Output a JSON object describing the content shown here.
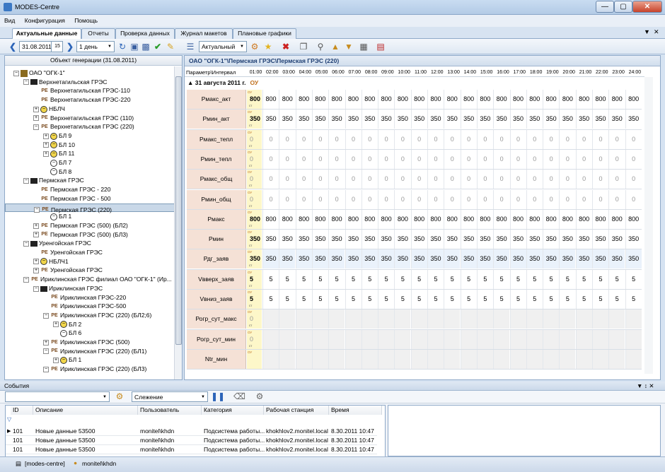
{
  "window": {
    "title": "MODES-Centre"
  },
  "menu": [
    "Вид",
    "Конфигурация",
    "Помощь"
  ],
  "tabs": [
    "Актуальные данные",
    "Отчеты",
    "Проверка данных",
    "Журнал макетов",
    "Плановые графики"
  ],
  "toolbar": {
    "date": "31.08.2011",
    "cal_day": "15",
    "period": "1 день",
    "mode": "Актуальный"
  },
  "left_panel": {
    "header": "Объект генерации (31.08.2011)",
    "tree": [
      {
        "label": "ОАО \"ОГК-1\"",
        "level": 0,
        "exp": "−",
        "icon": "org"
      },
      {
        "label": "Верхнетагильская ГРЭС",
        "level": 1,
        "exp": "−",
        "icon": "plant"
      },
      {
        "label": "Верхнетагильская ГРЭС-110",
        "level": 2,
        "exp": "",
        "icon": "pe"
      },
      {
        "label": "Верхнетагильская ГРЭС-220",
        "level": 2,
        "exp": "",
        "icon": "pe"
      },
      {
        "label": "НБЛЧ",
        "level": 2,
        "exp": "+",
        "icon": "geny"
      },
      {
        "label": "Верхнетагильская ГРЭС (110)",
        "level": 2,
        "exp": "+",
        "icon": "pe"
      },
      {
        "label": "Верхнетагильская ГРЭС (220)",
        "level": 2,
        "exp": "−",
        "icon": "pe"
      },
      {
        "label": "БЛ 9",
        "level": 3,
        "exp": "+",
        "icon": "geny"
      },
      {
        "label": "БЛ 10",
        "level": 3,
        "exp": "+",
        "icon": "geny"
      },
      {
        "label": "БЛ 11",
        "level": 3,
        "exp": "+",
        "icon": "geny"
      },
      {
        "label": "БЛ 7",
        "level": 3,
        "exp": "",
        "icon": "gen"
      },
      {
        "label": "БЛ 8",
        "level": 3,
        "exp": "",
        "icon": "gen"
      },
      {
        "label": "Пермская ГРЭС",
        "level": 1,
        "exp": "−",
        "icon": "plant"
      },
      {
        "label": "Пермская ГРЭС - 220",
        "level": 2,
        "exp": "",
        "icon": "pe"
      },
      {
        "label": "Пермская ГРЭС - 500",
        "level": 2,
        "exp": "",
        "icon": "pe"
      },
      {
        "label": "Пермская ГРЭС (220)",
        "level": 2,
        "exp": "−",
        "icon": "pe",
        "selected": true
      },
      {
        "label": "БЛ 1",
        "level": 3,
        "exp": "",
        "icon": "gen"
      },
      {
        "label": "Пермская ГРЭС (500) (БЛ2)",
        "level": 2,
        "exp": "+",
        "icon": "pe"
      },
      {
        "label": "Пермская ГРЭС (500) (БЛ3)",
        "level": 2,
        "exp": "+",
        "icon": "pe"
      },
      {
        "label": "Уренгойская ГРЭС",
        "level": 1,
        "exp": "−",
        "icon": "plant"
      },
      {
        "label": "Уренгойская ГРЭС",
        "level": 2,
        "exp": "",
        "icon": "pe"
      },
      {
        "label": "НБЛЧ1",
        "level": 2,
        "exp": "+",
        "icon": "geny"
      },
      {
        "label": "Уренгойская ГРЭС",
        "level": 2,
        "exp": "+",
        "icon": "pe"
      },
      {
        "label": "Ириклинская ГРЭС филиал ОАО \"ОГК-1\" (Ир...",
        "level": 1,
        "exp": "−",
        "icon": "pe"
      },
      {
        "label": "Ириклинская ГРЭС",
        "level": 2,
        "exp": "−",
        "icon": "plant"
      },
      {
        "label": "Ириклинская ГРЭС-220",
        "level": 3,
        "exp": "",
        "icon": "pe"
      },
      {
        "label": "Ириклинская ГРЭС-500",
        "level": 3,
        "exp": "",
        "icon": "pe"
      },
      {
        "label": "Ириклинская ГРЭС (220) (БЛ2;6)",
        "level": 3,
        "exp": "−",
        "icon": "pe"
      },
      {
        "label": "БЛ 2",
        "level": 4,
        "exp": "+",
        "icon": "geny"
      },
      {
        "label": "БЛ 6",
        "level": 4,
        "exp": "",
        "icon": "gen"
      },
      {
        "label": "Ириклинская ГРЭС (500)",
        "level": 3,
        "exp": "+",
        "icon": "pe"
      },
      {
        "label": "Ириклинская ГРЭС (220) (БЛ1)",
        "level": 3,
        "exp": "−",
        "icon": "pe"
      },
      {
        "label": "БЛ 1",
        "level": 4,
        "exp": "+",
        "icon": "geny"
      },
      {
        "label": "Ириклинская ГРЭС (220) (БЛ3)",
        "level": 3,
        "exp": "−",
        "icon": "pe"
      }
    ]
  },
  "right_panel": {
    "path": "ОАО \"ОГК-1\"\\Пермская ГРЭС\\Пермская ГРЭС (220)",
    "param_header": "Параметр\\Интервал",
    "hours": [
      "01:00",
      "02:00",
      "03:00",
      "04:00",
      "05:00",
      "06:00",
      "07:00",
      "08:00",
      "09:00",
      "10:00",
      "11:00",
      "12:00",
      "13:00",
      "14:00",
      "15:00",
      "16:00",
      "17:00",
      "18:00",
      "19:00",
      "20:00",
      "21:00",
      "22:00",
      "23:00",
      "24:00"
    ],
    "date_label": "31 августа 2011 г.",
    "status_label": "ОУ",
    "first_cell_tag": "ОУ",
    "first_cell_sub": "ст",
    "rows": [
      {
        "name": "Рмакс_акт",
        "value": "800",
        "style": "bold"
      },
      {
        "name": "Рмин_акт",
        "value": "350",
        "style": "bold"
      },
      {
        "name": "Рмакс_тепл",
        "value": "0",
        "style": "gray"
      },
      {
        "name": "Рмин_тепл",
        "value": "0",
        "style": "gray"
      },
      {
        "name": "Рмакс_общ",
        "value": "0",
        "style": "gray"
      },
      {
        "name": "Рмин_общ",
        "value": "0",
        "style": "gray"
      },
      {
        "name": "Рмакс",
        "value": "800",
        "style": "bold"
      },
      {
        "name": "Рмин",
        "value": "350",
        "style": "bold"
      },
      {
        "name": "Рдг_заяв",
        "value": "350",
        "style": "shade"
      },
      {
        "name": "Vвверх_заяв",
        "value": "5",
        "style": "bold"
      },
      {
        "name": "Vвниз_заяв",
        "value": "5",
        "style": "bold"
      },
      {
        "name": "Рогр_сут_макс",
        "value": "0",
        "style": "empty"
      },
      {
        "name": "Рогр_сут_мин",
        "value": "0",
        "style": "empty"
      },
      {
        "name": "Ntr_мин",
        "value": "",
        "style": "empty"
      }
    ]
  },
  "events": {
    "title": "События",
    "filter": "Слежение",
    "columns": [
      "ID",
      "Описание",
      "Пользователь",
      "Категория",
      "Рабочая станция",
      "Время"
    ],
    "rows": [
      [
        "101",
        "Новые данные 53500",
        "monitel\\khdn",
        "Подсистема работы...",
        "khokhlov2.monitel.local",
        "8.30.2011 10:47"
      ],
      [
        "101",
        "Новые данные 53500",
        "monitel\\khdn",
        "Подсистема работы...",
        "khokhlov2.monitel.local",
        "8.30.2011 10:47"
      ],
      [
        "101",
        "Новые данные 53500",
        "monitel\\khdn",
        "Подсистема работы...",
        "khokhlov2.monitel.local",
        "8.30.2011 10:47"
      ]
    ]
  },
  "status": {
    "server": "[modes-centre]",
    "user": "monitel\\khdn"
  }
}
